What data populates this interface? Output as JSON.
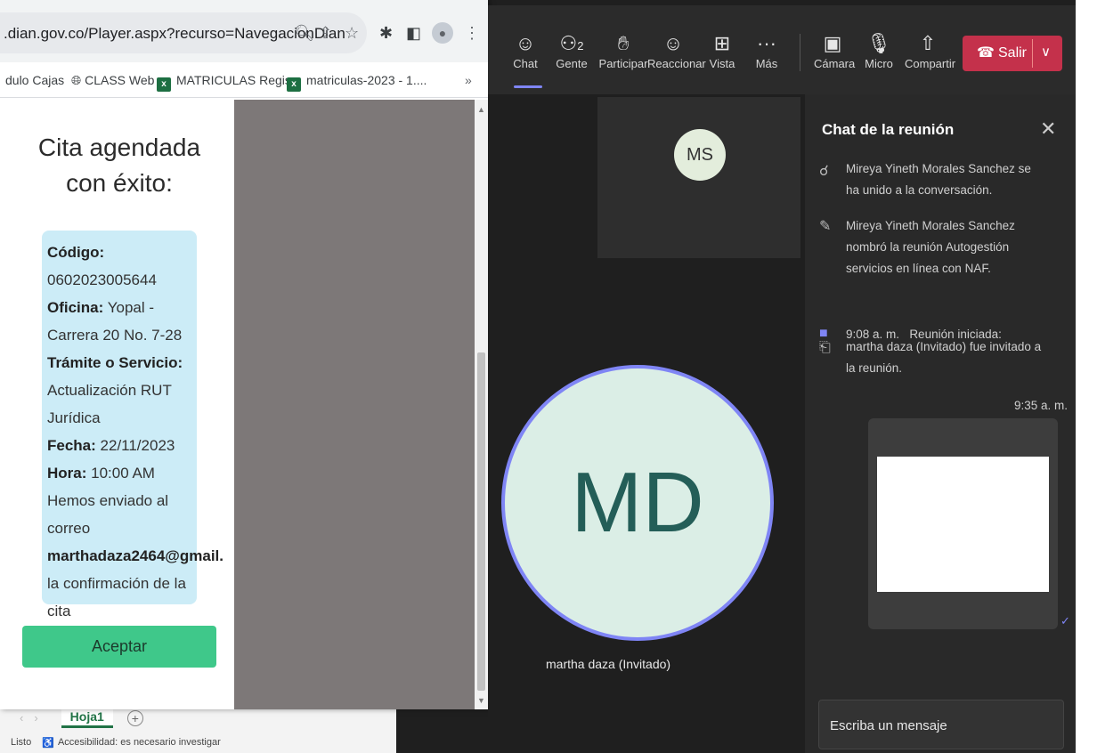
{
  "browser": {
    "url": ".dian.gov.co/Player.aspx?recurso=NavegacionDian",
    "bookmarks": [
      "dulo Cajas",
      "CLASS Web",
      "MATRICULAS Regis...",
      "matriculas-2023 - 1...."
    ],
    "more": "»"
  },
  "page": {
    "title": "Cita agendada con éxito:",
    "codigo_label": "Código:",
    "codigo": "0602023005644",
    "oficina_label": "Oficina:",
    "oficina": "Yopal - Carrera 20 No. 7-28",
    "tramite_label": "Trámite o Servicio:",
    "tramite": "Actualización RUT Jurídica",
    "fecha_label": "Fecha:",
    "fecha": "22/11/2023",
    "hora_label": "Hora:",
    "hora": "10:00 AM",
    "msg1": "Hemos enviado al correo",
    "email": "marthadaza2464@gmail.",
    "msg2": "la confirmación de la cita",
    "accept": "Aceptar"
  },
  "excel": {
    "sheet": "Hoja1",
    "status": "Listo",
    "accessibility": "Accesibilidad: es necesario investigar"
  },
  "toolbar": {
    "chat": "Chat",
    "people": "Gente",
    "people_count": "2",
    "raise": "Participar",
    "react": "Reaccionar",
    "view": "Vista",
    "more": "Más",
    "camera": "Cámara",
    "mic": "Micro",
    "share": "Compartir",
    "leave": "Salir"
  },
  "stage": {
    "ms": "MS",
    "md": "MD",
    "md_name": "martha daza (Invitado)"
  },
  "chat": {
    "title": "Chat de la reunión",
    "m1": "Mireya Yineth Morales Sanchez se ha unido a la conversación.",
    "m2": "Mireya Yineth Morales Sanchez nombró la reunión Autogestión servicios en línea con NAF.",
    "m3_time": "9:08 a. m.",
    "m3": "Reunión iniciada:",
    "m4": "martha daza (Invitado) fue invitado a la reunión.",
    "img_time": "9:35 a. m.",
    "composer": "Escriba un mensaje"
  }
}
